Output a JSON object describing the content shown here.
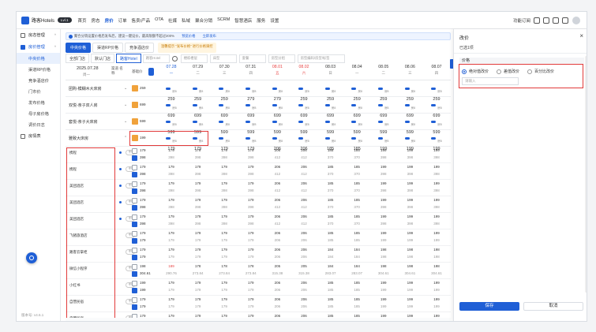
{
  "app": {
    "name": "路客Hotels",
    "badge": "Lvl.1"
  },
  "nav": [
    {
      "label": "首页"
    },
    {
      "label": "房态"
    },
    {
      "label": "房价",
      "active": true
    },
    {
      "label": "订单"
    },
    {
      "label": "售卖/产品"
    },
    {
      "label": "OTA"
    },
    {
      "label": "社媒"
    },
    {
      "label": "私域"
    },
    {
      "label": "聚合分销",
      "badge": "NEW"
    },
    {
      "label": "SCRM"
    },
    {
      "label": "智慧酒店"
    },
    {
      "label": "服务"
    },
    {
      "label": "设置"
    }
  ],
  "topright": {
    "label": "功能订阅"
  },
  "sidebar": {
    "groups": [
      {
        "label": "房态管理",
        "caret": "^",
        "items": []
      },
      {
        "label": "房价管理",
        "caret": "^",
        "active": true,
        "items": [
          {
            "label": "中央价格",
            "active": true
          },
          {
            "label": "渠道RP价格"
          },
          {
            "label": "竞争酒店价"
          },
          {
            "label": "门市价"
          },
          {
            "label": "发布价格"
          },
          {
            "label": "母子房价格"
          },
          {
            "label": "调价日志"
          }
        ]
      },
      {
        "label": "房情表",
        "caret": "",
        "items": []
      }
    ],
    "version": "版本号: v4.6.1"
  },
  "notice": {
    "text": "聚合分销设置价格后发布后，建议一键设价，最高限额不超过200%",
    "link1": "预览价格",
    "link2": "立即发布"
  },
  "tabs": [
    {
      "label": "中央价格",
      "active": true
    },
    {
      "label": "渠道RP价格"
    },
    {
      "label": "竞争酒店价"
    }
  ],
  "tab_note": "温馨提示 \"发布价格\" 进行价格调控",
  "filters": {
    "buttons": [
      "全部门店",
      "默认门店",
      "路客Hotel"
    ],
    "selects": [
      "路客Hotel",
      "楼栋楼层",
      "床型",
      "套餐",
      "房型分组",
      "房型编码/房型/标签"
    ]
  },
  "grid": {
    "date_label": "2025.07.28",
    "date_sub": "周一",
    "mid_header": "渠道 名称",
    "base_header": "基础价",
    "days": [
      {
        "d": "07.28",
        "w": "一",
        "cur": true
      },
      {
        "d": "07.29",
        "w": "二"
      },
      {
        "d": "07.30",
        "w": "三"
      },
      {
        "d": "07.31",
        "w": "四"
      },
      {
        "d": "08.01",
        "w": "五",
        "wk": true
      },
      {
        "d": "08.02",
        "w": "六",
        "wk": true
      },
      {
        "d": "08.03",
        "w": "日"
      },
      {
        "d": "08.04",
        "w": "一"
      },
      {
        "d": "08.05",
        "w": "二"
      },
      {
        "d": "08.06",
        "w": "三"
      },
      {
        "d": "08.07",
        "w": "四"
      }
    ],
    "toggle_label": "房8",
    "room_rows": [
      {
        "name": "团购-模糊木大床房",
        "base": "259",
        "vals": [
          "259",
          "259",
          "259",
          "279",
          "279",
          "259",
          "259",
          "259",
          "259",
          "259",
          "259"
        ]
      },
      {
        "name": "双悦-亲子双人房",
        "base": "699",
        "vals": [
          "699",
          "699",
          "699",
          "699",
          "699",
          "699",
          "699",
          "699",
          "699",
          "699",
          "699"
        ]
      },
      {
        "name": "套悦-亲子大床房",
        "base": "599",
        "vals": [
          "599",
          "599",
          "599",
          "599",
          "599",
          "599",
          "599",
          "599",
          "599",
          "599",
          "599"
        ]
      },
      {
        "name": "雅致大床房",
        "base": "199",
        "vals": [
          "179",
          "179",
          "179",
          "179",
          "206",
          "206",
          "185",
          "185",
          "199",
          "199",
          "199"
        ]
      }
    ],
    "channel_rows": [
      {
        "name": "携程",
        "tag": "中",
        "m1": "179",
        "m2": "398",
        "v1": [
          "179",
          "179",
          "179",
          "179",
          "206",
          "206",
          "185",
          "185",
          "199",
          "199",
          "199"
        ],
        "v2": [
          "398",
          "398",
          "398",
          "398",
          "412",
          "412",
          "370",
          "370",
          "398",
          "398",
          "398"
        ]
      },
      {
        "name": "携程",
        "tag": "中",
        "m1": "179",
        "m2": "398",
        "v1": [
          "179",
          "179",
          "179",
          "179",
          "206",
          "206",
          "185",
          "185",
          "199",
          "199",
          "199"
        ],
        "v2": [
          "398",
          "398",
          "398",
          "398",
          "412",
          "412",
          "370",
          "370",
          "398",
          "398",
          "398"
        ]
      },
      {
        "name": "美团酒店",
        "tag": "中",
        "m1": "179",
        "m2": "398",
        "v1": [
          "179",
          "179",
          "179",
          "179",
          "206",
          "206",
          "185",
          "185",
          "199",
          "199",
          "199"
        ],
        "v2": [
          "398",
          "398",
          "398",
          "398",
          "412",
          "412",
          "370",
          "370",
          "398",
          "398",
          "398"
        ]
      },
      {
        "name": "美团酒店",
        "tag": "中",
        "m1": "179",
        "m2": "398",
        "v1": [
          "179",
          "179",
          "179",
          "179",
          "206",
          "206",
          "185",
          "185",
          "199",
          "199",
          "199"
        ],
        "v2": [
          "398",
          "398",
          "398",
          "398",
          "412",
          "412",
          "370",
          "370",
          "398",
          "398",
          "398"
        ]
      },
      {
        "name": "美团酒店",
        "tag": "中",
        "m1": "179",
        "m2": "398",
        "v1": [
          "179",
          "179",
          "179",
          "179",
          "206",
          "206",
          "185",
          "185",
          "199",
          "199",
          "199"
        ],
        "v2": [
          "398",
          "398",
          "398",
          "398",
          "412",
          "412",
          "370",
          "370",
          "398",
          "398",
          "398"
        ]
      },
      {
        "name": "飞猪旅酒店",
        "tag": "中",
        "m1": "179",
        "m2": "179",
        "v1": [
          "179",
          "179",
          "179",
          "179",
          "206",
          "206",
          "185",
          "185",
          "199",
          "199",
          "199"
        ],
        "v2": [
          "179",
          "179",
          "179",
          "179",
          "206",
          "206",
          "185",
          "185",
          "199",
          "199",
          "199"
        ]
      },
      {
        "name": "路客云掌柜",
        "tag": "中",
        "m1": "179",
        "m2": "179",
        "v1": [
          "179",
          "179",
          "179",
          "179",
          "206",
          "206",
          "184",
          "184",
          "198",
          "198",
          "198"
        ],
        "v2": [
          "179",
          "179",
          "179",
          "179",
          "206",
          "206",
          "184",
          "184",
          "198",
          "198",
          "198"
        ]
      },
      {
        "name": "微信小程序",
        "tag": "中",
        "m1": "198",
        "m2": "304.61",
        "v1": [
          "189",
          "178",
          "178",
          "178",
          "205",
          "205",
          "184",
          "184",
          "198",
          "198",
          "198"
        ],
        "v2": [
          "290.76",
          "273.84",
          "273.84",
          "273.84",
          "315.38",
          "315.38",
          "283.07",
          "283.07",
          "304.61",
          "304.61",
          "304.61"
        ],
        "red_first": true
      },
      {
        "name": "小红书",
        "tag": "中",
        "m1": "199",
        "m2": "199",
        "v1": [
          "179",
          "179",
          "179",
          "179",
          "206",
          "206",
          "185",
          "185",
          "199",
          "199",
          "199"
        ],
        "v2": [
          "179",
          "179",
          "179",
          "179",
          "206",
          "206",
          "185",
          "185",
          "199",
          "199",
          "199"
        ]
      },
      {
        "name": "自营民宿",
        "tag": "中",
        "m1": "179",
        "m2": "179",
        "v1": [
          "179",
          "179",
          "179",
          "179",
          "206",
          "206",
          "185",
          "185",
          "199",
          "199",
          "199"
        ],
        "v2": [
          "179",
          "179",
          "179",
          "179",
          "206",
          "206",
          "185",
          "185",
          "199",
          "199",
          "199"
        ]
      },
      {
        "name": "自营民宿",
        "tag": "中",
        "m1": "179",
        "m2": "199",
        "v1": [
          "179",
          "179",
          "179",
          "179",
          "206",
          "206",
          "185",
          "185",
          "199",
          "199",
          "199"
        ],
        "v2": [
          "199",
          "199",
          "199",
          "199",
          "206",
          "206",
          "185",
          "185",
          "199",
          "199",
          "199"
        ]
      }
    ]
  },
  "panel": {
    "title": "改价",
    "close": "×",
    "selected": "已选1项",
    "section": "价格",
    "radios": [
      {
        "label": "绝对值改价",
        "on": true
      },
      {
        "label": "差值改价"
      },
      {
        "label": "百分比改价"
      }
    ],
    "input_placeholder": "请输入",
    "save": "保存",
    "cancel": "取消"
  },
  "colors": {
    "accent": "#1f5fd6",
    "highlight": "#e23a3a",
    "weekend": "#e84545"
  }
}
